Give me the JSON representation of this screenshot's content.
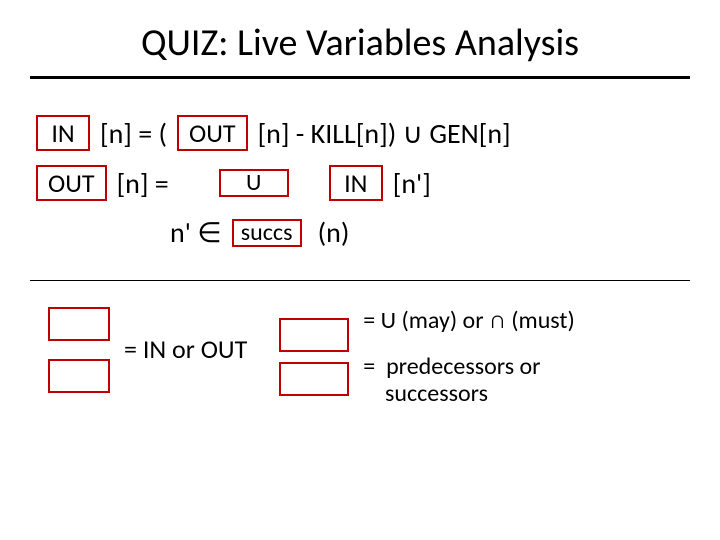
{
  "title": "QUIZ: Live Variables Analysis",
  "eq1": {
    "blank1": "IN",
    "t1": "[n] =   (",
    "blank2": "OUT",
    "t2": "[n] - KILL[n]) ∪ GEN[n]"
  },
  "eq2": {
    "blank1": "OUT",
    "t1": "[n] =",
    "blank2": "U",
    "blank3": "IN",
    "t2": "[n']"
  },
  "eq3": {
    "t1": "n' ∈",
    "blank1": "succs",
    "t2": "(n)"
  },
  "legend": {
    "mid": "= IN or OUT",
    "r1": "= U (may) or ∩ (must)",
    "r2": "=  predecessors or\n    successors"
  }
}
